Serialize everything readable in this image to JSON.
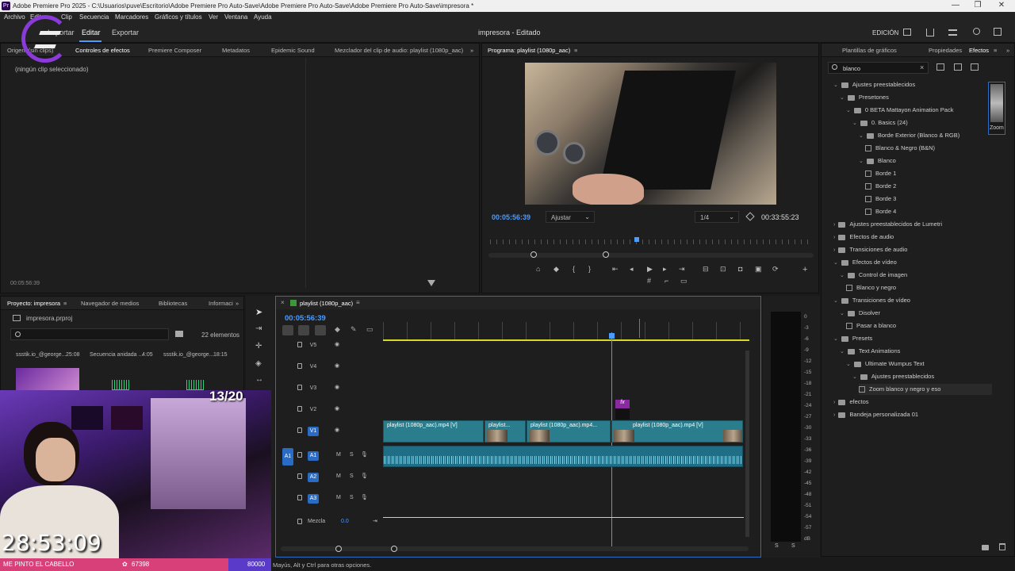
{
  "titlebar": {
    "icon": "Pr",
    "text": "Adobe Premiere Pro 2025 - C:\\Usuarios\\puve\\Escritorio\\Adobe Premiere Pro Auto-Save\\Adobe Premiere Pro Auto-Save\\Adobe Premiere Pro Auto-Save\\impresora *",
    "min": "—",
    "max": "❐",
    "close": "✕"
  },
  "menu": [
    "Archivo",
    "Editar",
    "Clip",
    "Secuencia",
    "Marcadores",
    "Gráficos y títulos",
    "Ver",
    "Ventana",
    "Ayuda"
  ],
  "header": {
    "import": "Importar",
    "edit": "Editar",
    "export": "Exportar",
    "project_title": "impresora - Editado",
    "workspace": "EDICIÓN"
  },
  "source_panel": {
    "tabs": [
      "Origen: (sin clips)",
      "Controles de efectos",
      "Premiere Composer",
      "Metadatos",
      "Epidemic Sound",
      "Mezclador del clip de audio: playlist (1080p_aac)"
    ],
    "no_clip": "(ningún clip seleccionado)",
    "timecode": "00:05:56:39"
  },
  "program": {
    "title": "Programa: playlist (1080p_aac)",
    "timecode": "00:05:56:39",
    "fit": "Ajustar",
    "resolution": "1/4",
    "duration": "00:33:55:23"
  },
  "effects_panel": {
    "tabs": [
      "Plantillas de gráficos",
      "Propiedades",
      "Efectos"
    ],
    "search_value": "blanco",
    "tree": [
      {
        "label": "Ajustes preestablecidos",
        "level": 0,
        "open": true,
        "kind": "folder"
      },
      {
        "label": "Presetones",
        "level": 1,
        "open": true,
        "kind": "folder"
      },
      {
        "label": "0 BETA Mattayon Animation Pack",
        "level": 2,
        "open": true,
        "kind": "folder"
      },
      {
        "label": "0. Basics (24)",
        "level": 3,
        "open": true,
        "kind": "folder"
      },
      {
        "label": "Borde Exterior (Blanco & RGB)",
        "level": 4,
        "open": true,
        "kind": "folder"
      },
      {
        "label": "Blanco & Negro (B&N)",
        "level": 5,
        "open": false,
        "kind": "fx"
      },
      {
        "label": "Blanco",
        "level": 4,
        "open": true,
        "kind": "folder"
      },
      {
        "label": "Borde 1",
        "level": 5,
        "open": false,
        "kind": "fx"
      },
      {
        "label": "Borde 2",
        "level": 5,
        "open": false,
        "kind": "fx"
      },
      {
        "label": "Borde 3",
        "level": 5,
        "open": false,
        "kind": "fx"
      },
      {
        "label": "Borde 4",
        "level": 5,
        "open": false,
        "kind": "fx"
      },
      {
        "label": "Ajustes preestablecidos de Lumetri",
        "level": 0,
        "open": false,
        "kind": "folder"
      },
      {
        "label": "Efectos de audio",
        "level": 0,
        "open": false,
        "kind": "folder"
      },
      {
        "label": "Transiciones de audio",
        "level": 0,
        "open": false,
        "kind": "folder"
      },
      {
        "label": "Efectos de vídeo",
        "level": 0,
        "open": true,
        "kind": "folder"
      },
      {
        "label": "Control de imagen",
        "level": 1,
        "open": true,
        "kind": "folder"
      },
      {
        "label": "Blanco y negro",
        "level": 2,
        "open": false,
        "kind": "fx"
      },
      {
        "label": "Transiciones de vídeo",
        "level": 0,
        "open": true,
        "kind": "folder"
      },
      {
        "label": "Disolver",
        "level": 1,
        "open": true,
        "kind": "folder"
      },
      {
        "label": "Pasar a blanco",
        "level": 2,
        "open": false,
        "kind": "fx"
      },
      {
        "label": "Presets",
        "level": 0,
        "open": true,
        "kind": "folder"
      },
      {
        "label": "Text Animations",
        "level": 1,
        "open": true,
        "kind": "folder"
      },
      {
        "label": "Ultimate Wumpus Text",
        "level": 2,
        "open": true,
        "kind": "folder"
      },
      {
        "label": "Ajustes preestablecidos",
        "level": 3,
        "open": true,
        "kind": "folder"
      },
      {
        "label": "Zoom blanco y negro y eso",
        "level": 4,
        "open": false,
        "kind": "fx",
        "selected": true
      },
      {
        "label": "efectos",
        "level": 0,
        "open": false,
        "kind": "folder"
      },
      {
        "label": "Bandeja personalizada 01",
        "level": 0,
        "open": false,
        "kind": "folder"
      }
    ],
    "preview_label": "Zoom"
  },
  "project_panel": {
    "tabs": [
      "Proyecto: impresora",
      "Navegador de medios",
      "Bibliotecas",
      "Informaci"
    ],
    "file": "impresora.prproj",
    "count": "22 elementos",
    "items": [
      {
        "name": "ssstik.io_@george...",
        "dur": "25:08"
      },
      {
        "name": "Secuencia anidada ...",
        "dur": "4:05"
      },
      {
        "name": "ssstik.io_@george...",
        "dur": "18:15"
      }
    ]
  },
  "timeline": {
    "tab": "playlist (1080p_aac)",
    "timecode": "00:05:56:39",
    "video_tracks": [
      "V5",
      "V4",
      "V3",
      "V2",
      "V1"
    ],
    "audio_tracks": [
      "A1",
      "A2",
      "A3"
    ],
    "src_patch": "A1",
    "mix_label": "Mezcla",
    "mix_value": "0.0",
    "clips_v1": [
      "playlist (1080p_aac).mp4 [V]",
      "playlist...",
      "playlist (1080p_aac).mp4...",
      "playlist (1080p_aac).mp4 [V]"
    ],
    "fx_badge": "fx",
    "mute": "M",
    "solo": "S"
  },
  "meter": {
    "scale": [
      "0",
      "-3",
      "-6",
      "-9",
      "-12",
      "-15",
      "-18",
      "-21",
      "-24",
      "-27",
      "-30",
      "-33",
      "-36",
      "-39",
      "-42",
      "-45",
      "-48",
      "-51",
      "-54",
      "-57",
      "dB"
    ],
    "solo_left": "S",
    "solo_right": "S"
  },
  "status": {
    "text": "Mayús, Alt y Ctrl para otras opciones."
  },
  "overlay": {
    "counter": "13/20",
    "timer": "28:53:09",
    "goal_text": "ME PINTO EL CABELLO",
    "goal_current": "67398",
    "goal_target": "80000"
  }
}
